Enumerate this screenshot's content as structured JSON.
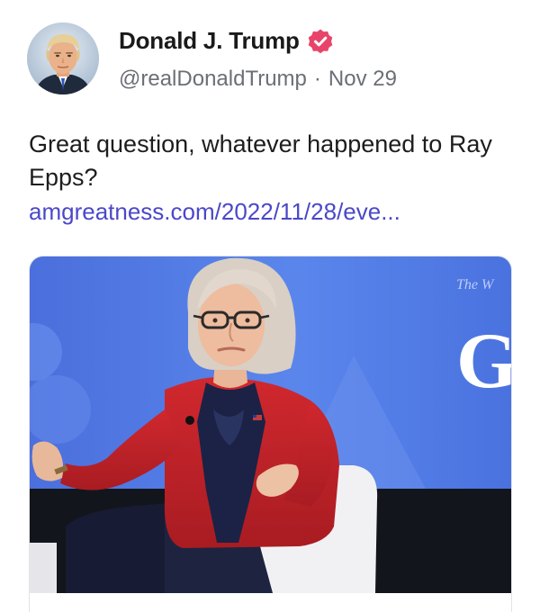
{
  "author": {
    "display_name": "Donald J. Trump",
    "handle": "@realDonaldTrump",
    "date": "Nov 29",
    "separator": "·",
    "verified_badge_color": "#e8446a"
  },
  "post": {
    "text": "Great question, whatever happened to Ray Epps?",
    "link_text": "amgreatness.com/2022/11/28/eve...",
    "link_color": "#4b48c9"
  },
  "media": {
    "backdrop_lettering": "The W",
    "backdrop_big_letter": "G",
    "backdrop_color": "#4f79e6"
  }
}
